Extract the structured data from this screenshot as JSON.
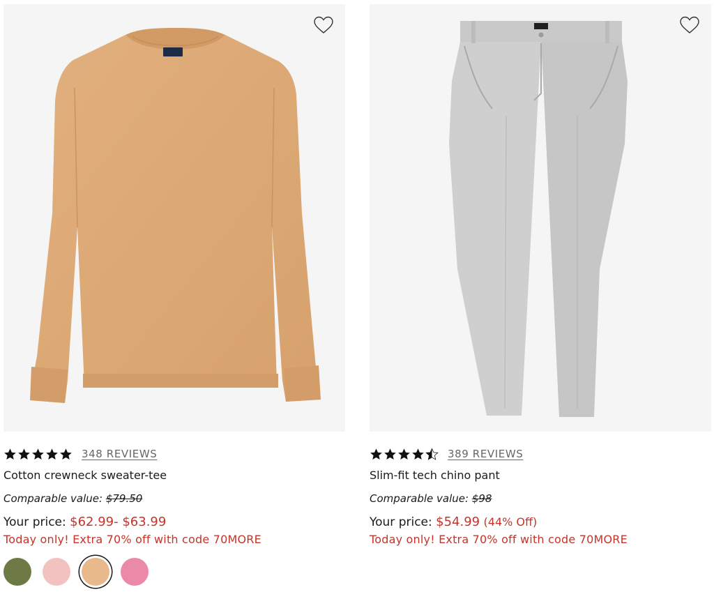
{
  "products": [
    {
      "rating": 4.8,
      "reviews_label": "348 REVIEWS",
      "name": "Cotton crewneck sweater-tee",
      "comparable_label": "Comparable value:",
      "comparable_price": "$79.50",
      "your_price_label": "Your price:",
      "your_price": "$62.99- $63.99",
      "discount": "",
      "promo": "Today only! Extra 70% off with code 70MORE",
      "favorite_icon": "heart-outline-icon",
      "swatches": [
        {
          "color": "#6e7a45",
          "selected": false
        },
        {
          "color": "#f2c2c0",
          "selected": false
        },
        {
          "color": "#e8b98a",
          "selected": true
        },
        {
          "color": "#ea8aa8",
          "selected": false
        }
      ]
    },
    {
      "rating": 4.6,
      "reviews_label": "389 REVIEWS",
      "name": "Slim-fit tech chino pant",
      "comparable_label": "Comparable value:",
      "comparable_price": "$98",
      "your_price_label": "Your price:",
      "your_price": "$54.99",
      "discount": "(44% Off)",
      "promo": "Today only! Extra 70% off with code 70MORE",
      "favorite_icon": "heart-outline-icon"
    }
  ],
  "colors": {
    "accent_red": "#c4342a",
    "image_bg": "#f5f5f5"
  }
}
